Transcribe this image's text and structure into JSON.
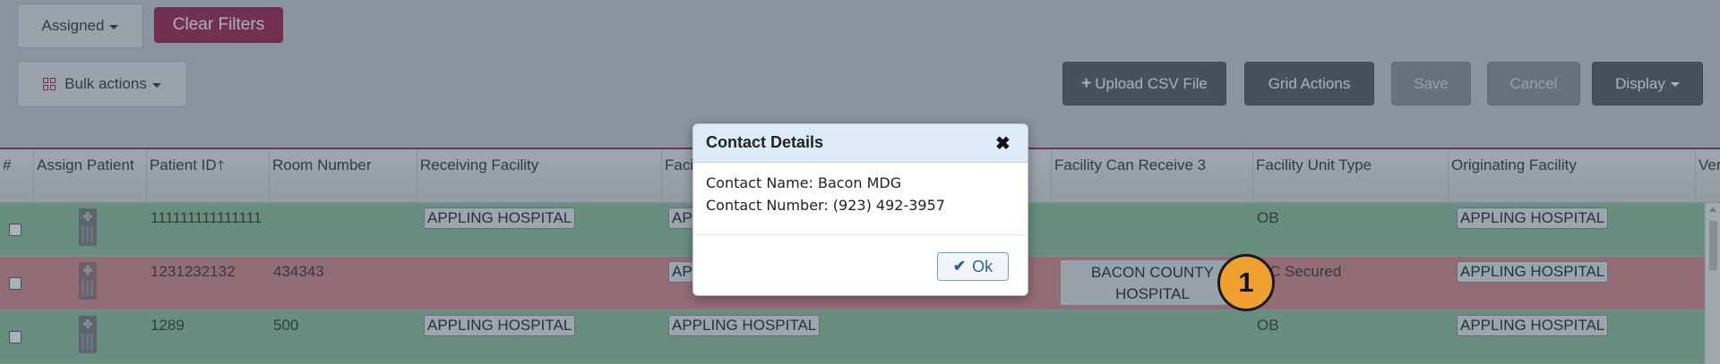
{
  "toolbar": {
    "assigned_label": "Assigned",
    "clear_filters_label": "Clear Filters",
    "bulk_actions_label": "Bulk actions",
    "upload_csv_label": "Upload CSV File",
    "grid_actions_label": "Grid Actions",
    "save_label": "Save",
    "cancel_label": "Cancel",
    "display_label": "Display"
  },
  "grid": {
    "columns": [
      "#",
      "Assign Patient",
      "Patient ID",
      "Room Number",
      "Receiving Facility",
      "Faci",
      "Facility Can Receive 3",
      "Facility Unit Type",
      "Originating Facility",
      "Ver"
    ],
    "rows": [
      {
        "status": "green",
        "patient_id": "111111111111111",
        "room_number": "",
        "receiving_facility": "APPLING HOSPITAL",
        "facility_col": "AP",
        "facility_can_receive_3": "",
        "facility_unit_type": "OB",
        "originating_facility": "APPLING HOSPITAL"
      },
      {
        "status": "red",
        "patient_id": "1231232132",
        "room_number": "434343",
        "receiving_facility": "",
        "facility_col": "AP",
        "facility_can_receive_3": "BACON COUNTY HOSPITAL",
        "facility_unit_type": "C Secured",
        "originating_facility": "APPLING HOSPITAL"
      },
      {
        "status": "green",
        "patient_id": "1289",
        "room_number": "500",
        "receiving_facility": "APPLING HOSPITAL",
        "facility_col": "APPLING HOSPITAL",
        "facility_can_receive_3": "",
        "facility_unit_type": "OB",
        "originating_facility": "APPLING HOSPITAL"
      }
    ]
  },
  "modal": {
    "title": "Contact Details",
    "close_glyph": "✖",
    "contact_name": "Contact Name: Bacon MDG",
    "contact_number": "Contact Number: (923) 492-3957",
    "ok_label": "Ok"
  },
  "step_marker": "1",
  "colors": {
    "accent": "#a3234a",
    "row_green": "#8fc39a",
    "row_red": "#d98a8a",
    "marker": "#f0a031"
  }
}
